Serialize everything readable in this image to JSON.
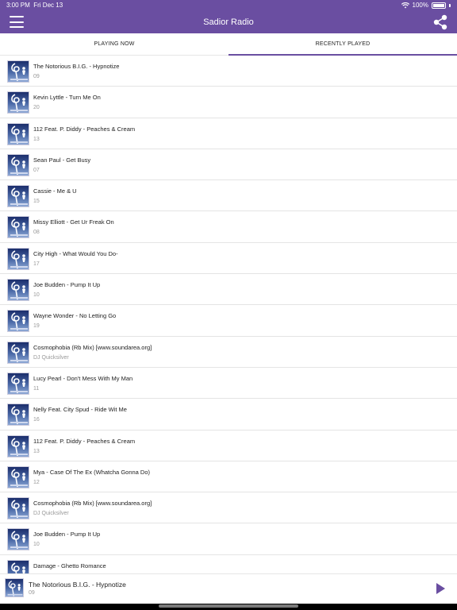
{
  "status_bar": {
    "time": "3:00 PM",
    "date": "Fri Dec 13",
    "battery": "100%",
    "wifi_icon": "wifi-icon"
  },
  "header": {
    "title": "Sadior Radio",
    "menu_icon": "hamburger-menu-icon",
    "share_icon": "share-icon",
    "background_color": "#6a4ea1"
  },
  "tabs": [
    {
      "label": "PLAYING NOW",
      "active": false
    },
    {
      "label": "RECENTLY PLAYED",
      "active": true
    }
  ],
  "recently_played": [
    {
      "title": "The Notorious B.I.G. - Hypnotize",
      "subtitle": "09"
    },
    {
      "title": "Kevin Lyttle - Turn Me On",
      "subtitle": "20"
    },
    {
      "title": "112 Feat. P. Diddy - Peaches & Cream",
      "subtitle": "13"
    },
    {
      "title": "Sean Paul - Get Busy",
      "subtitle": "07"
    },
    {
      "title": "Cassie - Me & U",
      "subtitle": "15"
    },
    {
      "title": "Missy Elliott - Get Ur Freak On",
      "subtitle": "08"
    },
    {
      "title": "City High - What Would You Do-",
      "subtitle": "17"
    },
    {
      "title": "Joe Budden - Pump It Up",
      "subtitle": "10"
    },
    {
      "title": "Wayne Wonder - No Letting Go",
      "subtitle": "19"
    },
    {
      "title": "Cosmophobia (Rb Mix) [www.soundarea.org]",
      "subtitle": "DJ Quicksilver"
    },
    {
      "title": "Lucy Pearl - Don't Mess With My Man",
      "subtitle": "11"
    },
    {
      "title": "Nelly Feat. City Spud - Ride Wit Me",
      "subtitle": "16"
    },
    {
      "title": "112 Feat. P. Diddy - Peaches & Cream",
      "subtitle": "13"
    },
    {
      "title": "Mya - Case Of The Ex (Whatcha Gonna Do)",
      "subtitle": "12"
    },
    {
      "title": "Cosmophobia (Rb Mix) [www.soundarea.org]",
      "subtitle": "DJ Quicksilver"
    },
    {
      "title": "Joe Budden - Pump It Up",
      "subtitle": "10"
    },
    {
      "title": "Damage - Ghetto Romance",
      "subtitle": ""
    }
  ],
  "now_playing": {
    "title": "The Notorious B.I.G. - Hypnotize",
    "subtitle": "09",
    "play_icon": "play-icon"
  }
}
